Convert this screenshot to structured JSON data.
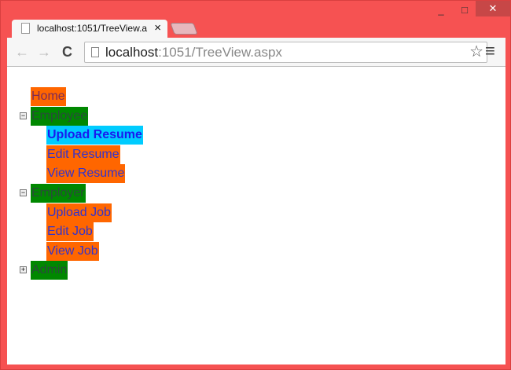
{
  "window": {
    "minimize": "_",
    "maximize": "□",
    "close": "✕"
  },
  "tab": {
    "title": "localhost:1051/TreeView.a",
    "close": "×"
  },
  "toolbar": {
    "back": "←",
    "forward": "→",
    "reload": "C",
    "url_host": "localhost",
    "url_path": ":1051/TreeView.aspx",
    "star": "☆",
    "menu": "≡"
  },
  "tree": {
    "home": "Home",
    "employee": {
      "label": "Employee",
      "toggle": "−",
      "children": [
        "Upload Resume",
        "Edit Resume",
        "View Resume"
      ]
    },
    "employer": {
      "label": "Employer",
      "toggle": "−",
      "children": [
        "Upload Job",
        "Edit Job",
        "View Job"
      ]
    },
    "admin": {
      "label": "Admin",
      "toggle": "+"
    }
  },
  "colors": {
    "leaf": "#ff6600",
    "parent": "#008800",
    "selected": "#00ccff",
    "link": "#3333cc"
  }
}
